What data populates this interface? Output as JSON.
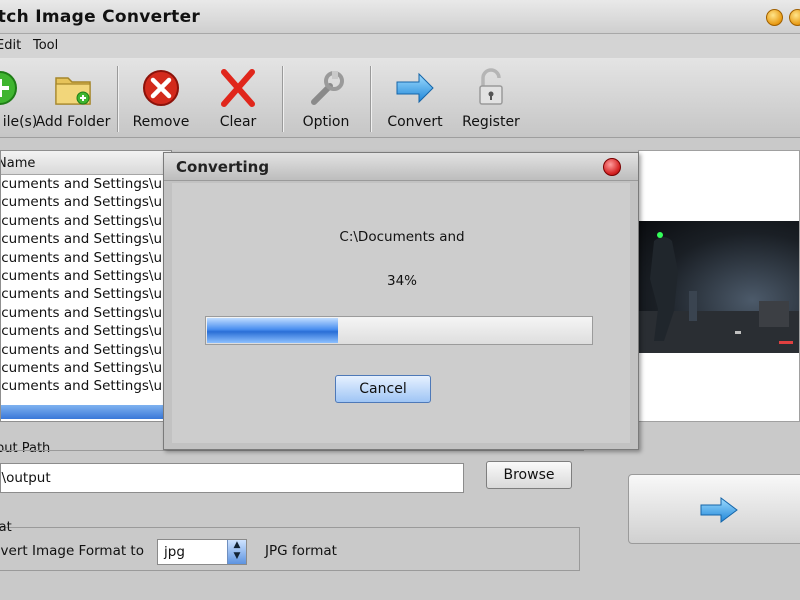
{
  "window": {
    "title": "atch Image Converter"
  },
  "menu": {
    "items": [
      "Edit",
      "Tool"
    ]
  },
  "toolbar": {
    "add_files": "ile(s)",
    "add_folder": "Add Folder",
    "remove": "Remove",
    "clear": "Clear",
    "option": "Option",
    "convert": "Convert",
    "register": "Register"
  },
  "file_list": {
    "header": "Name",
    "rows": [
      "ocuments and Settings\\up",
      "ocuments and Settings\\up",
      "ocuments and Settings\\up",
      "ocuments and Settings\\up",
      "ocuments and Settings\\up",
      "ocuments and Settings\\up",
      "ocuments and Settings\\up",
      "ocuments and Settings\\up",
      "ocuments and Settings\\up",
      "ocuments and Settings\\up",
      "ocuments and Settings\\up",
      "ocuments and Settings\\up"
    ]
  },
  "output": {
    "label": "put Path",
    "value": ":\\output",
    "browse_label": "Browse"
  },
  "format": {
    "group_label": "mat",
    "convert_label": "nvert Image Format to",
    "selected": "jpg",
    "description": "JPG format"
  },
  "dialog": {
    "title": "Converting",
    "file_text": "C:\\Documents and",
    "percent_text": "34%",
    "progress": 0.34,
    "cancel_label": "Cancel"
  },
  "colors": {
    "progress_accent": "#2a6fd6",
    "close_red": "#d52222",
    "remove_red": "#d32a1c"
  }
}
